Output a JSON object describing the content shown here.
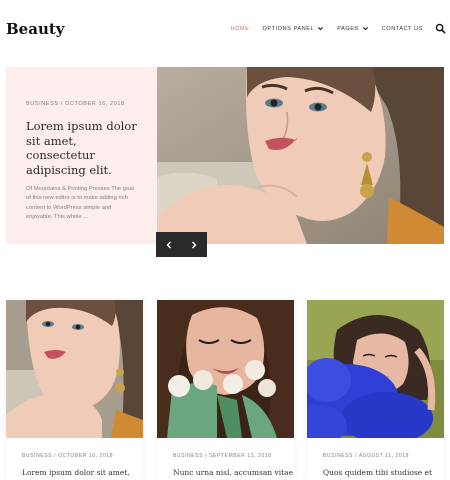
{
  "site": {
    "title": "Beauty"
  },
  "nav": {
    "items": [
      {
        "label": "HOME",
        "active": true,
        "has_dropdown": false
      },
      {
        "label": "OPTIONS PANEL",
        "active": false,
        "has_dropdown": true
      },
      {
        "label": "PAGES",
        "active": false,
        "has_dropdown": true
      },
      {
        "label": "CONTACT US",
        "active": false,
        "has_dropdown": false
      }
    ],
    "search_icon": "search-icon"
  },
  "hero": {
    "category": "BUSINESS",
    "separator": "/",
    "date": "OCTOBER 16, 2018",
    "title": "Lorem ipsum dolor sit amet, consectetur adipiscing elit.",
    "excerpt": "Of Mountains & Printing Presses The goal of this new editor is to make adding rich content to WordPress simple and enjoyable. This whole ...",
    "prev_icon": "chevron-left-icon",
    "next_icon": "chevron-right-icon"
  },
  "posts": [
    {
      "category": "BUSINESS",
      "date": "OCTOBER 16, 2018",
      "title": "Lorem ipsum dolor sit amet,"
    },
    {
      "category": "BUSINESS",
      "date": "SEPTEMBER 13, 2018",
      "title": "Nunc urna nisl, accumsan vitae"
    },
    {
      "category": "BUSINESS",
      "date": "AUGUST 11, 2018",
      "title": "Quos quidem tibi studiose et"
    }
  ],
  "colors": {
    "accent": "#d06a6a",
    "hero_card_bg": "#fdeeed",
    "slider_bg": "#2a2a2a"
  }
}
